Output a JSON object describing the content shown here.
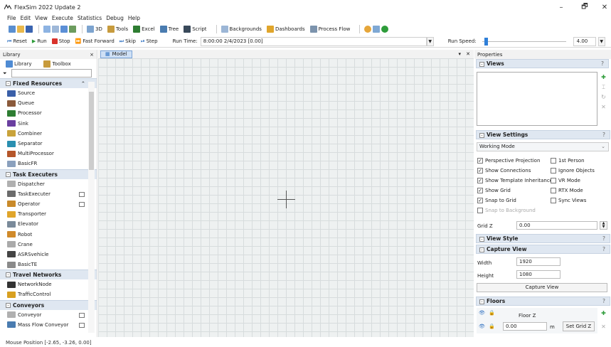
{
  "window": {
    "title": "FlexSim 2022 Update 2",
    "minimize": "–",
    "restore": "🗗",
    "close": "✕"
  },
  "menu": [
    "File",
    "Edit",
    "View",
    "Execute",
    "Statistics",
    "Debug",
    "Help"
  ],
  "toolbar": {
    "btn_3d": "3D",
    "tools": "Tools",
    "excel": "Excel",
    "tree": "Tree",
    "script": "Script",
    "backgrounds": "Backgrounds",
    "dashboards": "Dashboards",
    "process_flow": "Process Flow"
  },
  "runbar": {
    "reset": "Reset",
    "run": "Run",
    "stop": "Stop",
    "fast_forward": "Fast Forward",
    "skip": "Skip",
    "step": "Step",
    "run_time_label": "Run Time:",
    "run_time_value": "8:00:00  2/4/2023  [0.00]",
    "run_speed_label": "Run Speed:",
    "run_speed_value": "4.00",
    "speed_fraction": 0.03
  },
  "library": {
    "title": "Library",
    "close": "×",
    "tab_library": "Library",
    "tab_toolbox": "Toolbox",
    "categories": [
      {
        "name": "Fixed Resources",
        "items": [
          "Source",
          "Queue",
          "Processor",
          "Sink",
          "Combiner",
          "Separator",
          "MultiProcessor",
          "BasicFR"
        ]
      },
      {
        "name": "Task Executers",
        "items": [
          "Dispatcher",
          "TaskExecuter",
          "Operator",
          "Transporter",
          "Elevator",
          "Robot",
          "Crane",
          "ASRSvehicle",
          "BasicTE"
        ]
      },
      {
        "name": "Travel Networks",
        "items": [
          "NetworkNode",
          "TrafficControl"
        ]
      },
      {
        "name": "Conveyors",
        "items": [
          "Conveyor",
          "Mass Flow Conveyor"
        ]
      }
    ]
  },
  "model_tab": {
    "label": "Model",
    "dropdown": "▾",
    "close": "✕"
  },
  "properties": {
    "title": "Properties",
    "views": {
      "label": "Views",
      "help": "?"
    },
    "view_settings": {
      "label": "View Settings",
      "help": "?",
      "working_mode": "Working Mode",
      "checks": [
        {
          "label": "Perspective Projection",
          "checked": true
        },
        {
          "label": "1st Person",
          "checked": false
        },
        {
          "label": "Show Connections",
          "checked": true
        },
        {
          "label": "Ignore Objects",
          "checked": false
        },
        {
          "label": "Show Template Inheritance",
          "checked": true
        },
        {
          "label": "VR Mode",
          "checked": false
        },
        {
          "label": "Show Grid",
          "checked": true
        },
        {
          "label": "RTX Mode",
          "checked": false
        },
        {
          "label": "Snap to Grid",
          "checked": true
        },
        {
          "label": "Sync Views",
          "checked": false
        },
        {
          "label": "Snap to Background",
          "checked": false
        }
      ],
      "grid_z_label": "Grid Z",
      "grid_z_value": "0.00"
    },
    "view_style": {
      "label": "View Style",
      "help": "?"
    },
    "capture_view": {
      "label": "Capture View",
      "help": "?",
      "width_label": "Width",
      "width_value": "1920",
      "height_label": "Height",
      "height_value": "1080",
      "button": "Capture View"
    },
    "floors": {
      "label": "Floors",
      "help": "?",
      "floor_name": "Floor Z",
      "floor_value": "0.00",
      "unit": "m",
      "set_button": "Set Grid Z"
    }
  },
  "status": {
    "mouse_position": "Mouse Position [-2.65, -3.26, 0.00]"
  }
}
